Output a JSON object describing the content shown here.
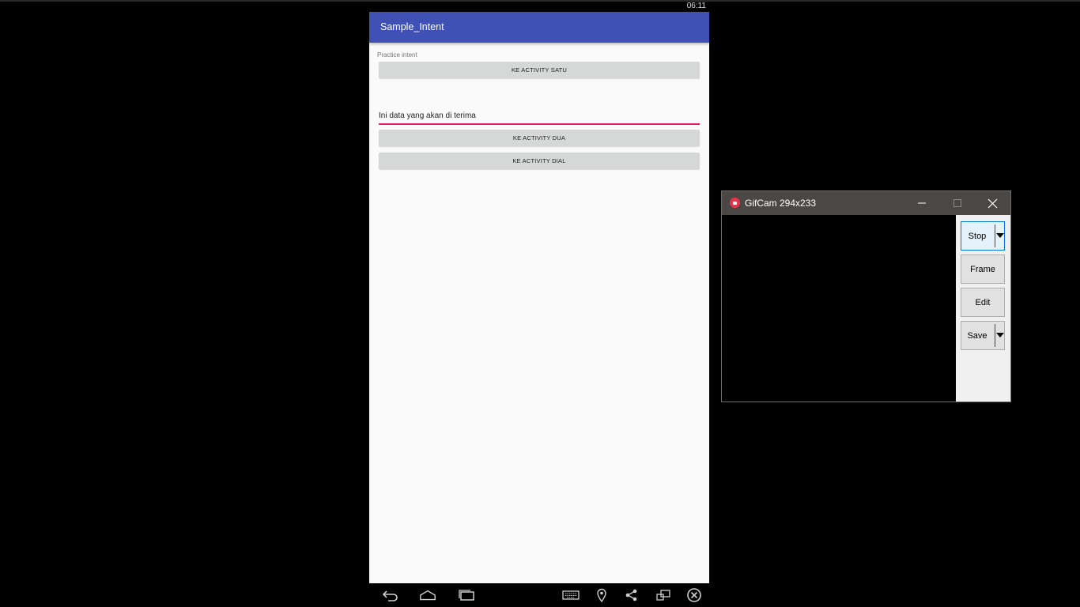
{
  "status_bar": {
    "time": "06:11"
  },
  "app": {
    "title": "Sample_Intent",
    "caption": "Practice intent",
    "button_satu": "KE ACTIVITY SATU",
    "edit_text": "Ini data yang akan di terima",
    "button_dua": "KE ACTIVITY DUA",
    "button_dial": "KE ACTIVITY DIAL",
    "accent_color": "#3f51b5",
    "edit_underline_color": "#e91e63"
  },
  "navbar": {
    "icons": [
      "back-icon",
      "home-icon",
      "recents-icon",
      "keyboard-icon",
      "location-icon",
      "share-icon",
      "rotate-icon",
      "close-icon"
    ]
  },
  "gifcam": {
    "title": "GifCam 294x233",
    "buttons": {
      "stop": "Stop",
      "frame": "Frame",
      "edit": "Edit",
      "save": "Save"
    }
  }
}
